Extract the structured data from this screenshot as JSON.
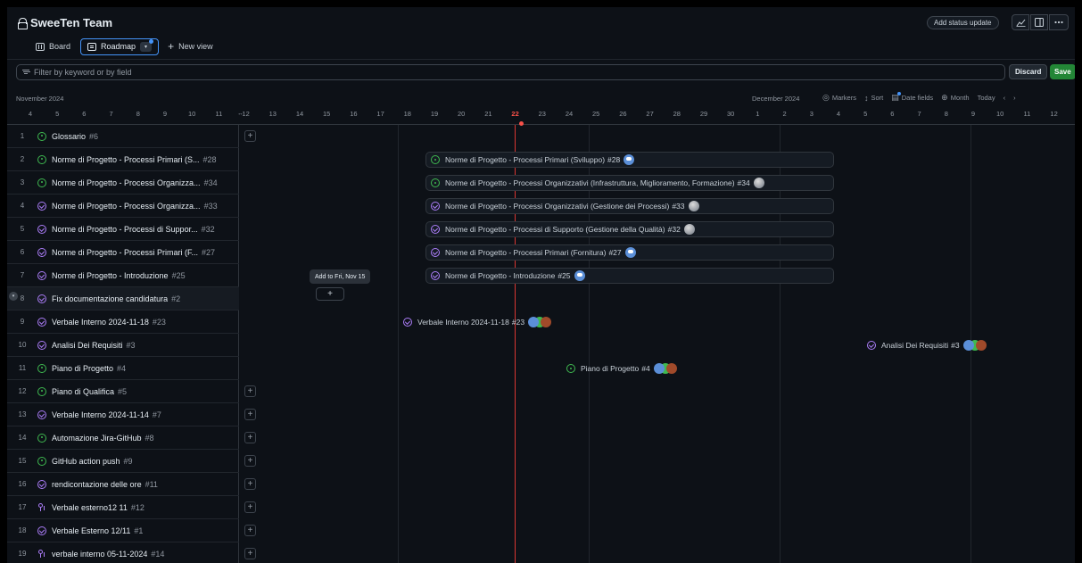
{
  "header": {
    "title": "SweeTen Team",
    "status_button": "Add status update",
    "tools": [
      "chart-icon",
      "panel-icon",
      "more-icon"
    ]
  },
  "tabs": [
    {
      "label": "Board",
      "icon": "board-icon",
      "active": false
    },
    {
      "label": "Roadmap",
      "icon": "roadmap-icon",
      "active": true
    }
  ],
  "new_view": "New view",
  "filter": {
    "placeholder": "Filter by keyword or by field"
  },
  "actions": {
    "discard": "Discard",
    "save": "Save"
  },
  "timeline": {
    "month_left": "November 2024",
    "month_right": "December 2024",
    "controls": [
      {
        "icon": "markers-icon",
        "label": "Markers"
      },
      {
        "icon": "sort-icon",
        "label": "Sort"
      },
      {
        "icon": "date-fields-icon",
        "label": "Date fields"
      },
      {
        "icon": "zoom-icon",
        "label": "Month"
      },
      {
        "icon": "",
        "label": "Today"
      }
    ],
    "days": [
      "4",
      "5",
      "6",
      "7",
      "8",
      "9",
      "10",
      "11",
      "12",
      "13",
      "14",
      "15",
      "16",
      "17",
      "18",
      "19",
      "20",
      "21",
      "22",
      "23",
      "24",
      "25",
      "26",
      "27",
      "28",
      "29",
      "30",
      "1",
      "2",
      "3",
      "4",
      "5",
      "6",
      "7",
      "8",
      "9",
      "10",
      "11",
      "12"
    ],
    "today": "22"
  },
  "rows": [
    {
      "n": "1",
      "status": "open",
      "title": "Glossario",
      "num": "#6"
    },
    {
      "n": "2",
      "status": "open",
      "title": "Norme di Progetto - Processi Primari (S...",
      "num": "#28"
    },
    {
      "n": "3",
      "status": "open",
      "title": "Norme di Progetto - Processi Organizza...",
      "num": "#34"
    },
    {
      "n": "4",
      "status": "closed",
      "title": "Norme di Progetto - Processi Organizza...",
      "num": "#33"
    },
    {
      "n": "5",
      "status": "closed",
      "title": "Norme di Progetto - Processi di Suppor...",
      "num": "#32"
    },
    {
      "n": "6",
      "status": "closed",
      "title": "Norme di Progetto - Processi Primari (F...",
      "num": "#27"
    },
    {
      "n": "7",
      "status": "closed",
      "title": "Norme di Progetto - Introduzione",
      "num": "#25"
    },
    {
      "n": "8",
      "status": "closed",
      "title": "Fix documentazione candidatura",
      "num": "#2"
    },
    {
      "n": "9",
      "status": "closed",
      "title": "Verbale Interno 2024-11-18",
      "num": "#23"
    },
    {
      "n": "10",
      "status": "closed",
      "title": "Analisi Dei Requisiti",
      "num": "#3"
    },
    {
      "n": "11",
      "status": "open",
      "title": "Piano di Progetto",
      "num": "#4"
    },
    {
      "n": "12",
      "status": "open",
      "title": "Piano di Qualifica",
      "num": "#5"
    },
    {
      "n": "13",
      "status": "closed",
      "title": "Verbale Interno 2024-11-14",
      "num": "#7"
    },
    {
      "n": "14",
      "status": "open",
      "title": "Automazione Jira-GitHub",
      "num": "#8"
    },
    {
      "n": "15",
      "status": "open",
      "title": "GitHub action push",
      "num": "#9"
    },
    {
      "n": "16",
      "status": "closed",
      "title": "rendicontazione delle ore",
      "num": "#11"
    },
    {
      "n": "17",
      "status": "pr",
      "title": "Verbale esterno12 11",
      "num": "#12"
    },
    {
      "n": "18",
      "status": "closed",
      "title": "Verbale Esterno 12/11",
      "num": "#1"
    },
    {
      "n": "19",
      "status": "pr",
      "title": "verbale interno 05-11-2024",
      "num": "#14"
    }
  ],
  "bars": [
    {
      "row": 1,
      "status": "open",
      "title": "Norme di Progetto - Processi Primari (Sviluppo)",
      "num": "#28",
      "avatar": "blue"
    },
    {
      "row": 2,
      "status": "open",
      "title": "Norme di Progetto - Processi Organizzativi (Infrastruttura, Miglioramento, Formazione)",
      "num": "#34",
      "avatar": "gray"
    },
    {
      "row": 3,
      "status": "closed",
      "title": "Norme di Progetto - Processi Organizzativi (Gestione dei Processi)",
      "num": "#33",
      "avatar": "gray"
    },
    {
      "row": 4,
      "status": "closed",
      "title": "Norme di Progetto - Processi di Supporto (Gestione della Qualità)",
      "num": "#32",
      "avatar": "gray"
    },
    {
      "row": 5,
      "status": "closed",
      "title": "Norme di Progetto - Processi Primari (Fornitura)",
      "num": "#27",
      "avatar": "blue"
    },
    {
      "row": 6,
      "status": "closed",
      "title": "Norme di Progetto - Introduzione",
      "num": "#25",
      "avatar": "blue"
    },
    {
      "row": 8,
      "status": "closed",
      "title": "Verbale Interno 2024-11-18",
      "num": "#23",
      "avatar": "multi"
    },
    {
      "row": 9,
      "status": "closed",
      "title": "Analisi Dei Requisiti",
      "num": "#3",
      "avatar": "multi"
    },
    {
      "row": 10,
      "status": "open",
      "title": "Piano di Progetto",
      "num": "#4",
      "avatar": "multi"
    }
  ],
  "tooltip": "Add to Fri, Nov 15"
}
